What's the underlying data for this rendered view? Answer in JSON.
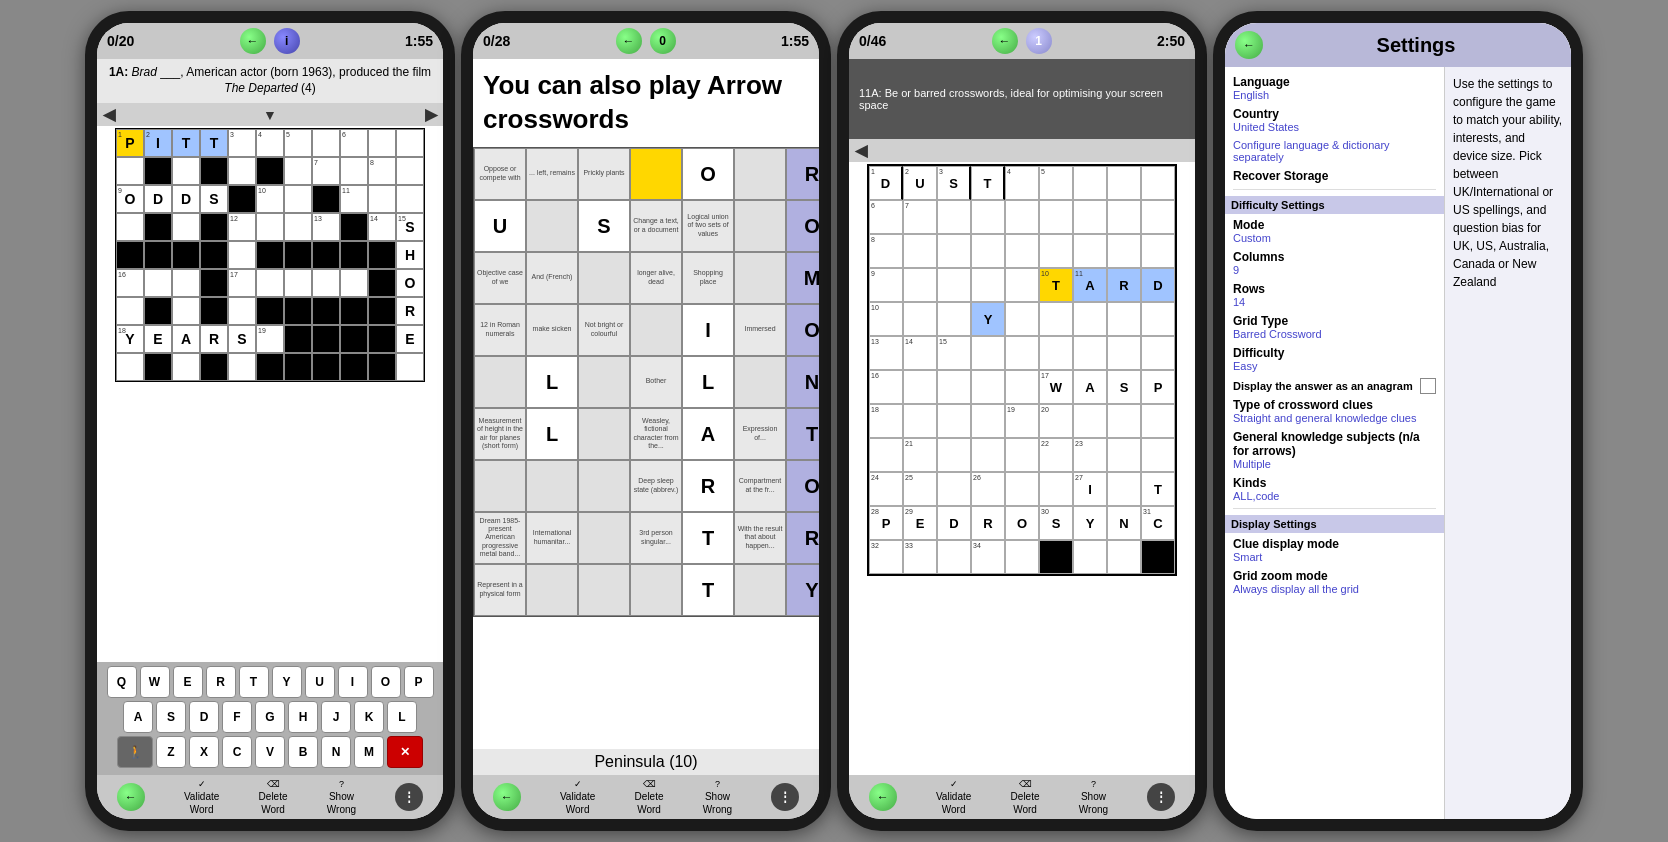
{
  "phones": [
    {
      "id": "phone1",
      "score": "0/20",
      "time": "1:55",
      "clue": "1A: Brad ___, American actor (born 1963), produced the film The Departed (4)",
      "clue_italic": "The Departed",
      "bottom_buttons": [
        "Validate\nWord",
        "Delete\nWord",
        "Show\nWrong"
      ],
      "grid": {
        "cols": 11,
        "rows": 9,
        "highlighted_word": "PITT"
      }
    },
    {
      "id": "phone2",
      "score": "0/28",
      "time": "1:55",
      "big_clue": "You can also play Arrow crosswords",
      "peninsula_label": "Peninsula (10)",
      "bottom_buttons": [
        "Validate\nWord",
        "Delete\nWord",
        "Show\nWrong"
      ]
    },
    {
      "id": "phone3",
      "score": "0/46",
      "time": "2:50",
      "clue": "11A: Be or barred crosswords, ideal for optimising your screen space",
      "bottom_buttons": [
        "Validate\nWord",
        "Delete\nWord",
        "Show\nWrong"
      ]
    },
    {
      "id": "phone4",
      "title": "Settings",
      "right_text": "Use the settings to configure the game to match your ability, interests, and device size. Pick between UK/International or US spellings, and question bias for UK, US, Australia, Canada or New Zealand",
      "sections": [
        {
          "label": "",
          "items": [
            {
              "label": "Language",
              "value": "English"
            },
            {
              "label": "Country",
              "value": "United States"
            },
            {
              "label": "Configure language & dictionary separately",
              "value": ""
            },
            {
              "label": "Recover Storage",
              "value": ""
            }
          ]
        },
        {
          "label": "Difficulty Settings",
          "items": [
            {
              "label": "Mode",
              "value": "Custom"
            },
            {
              "label": "Columns",
              "value": "9"
            },
            {
              "label": "Rows",
              "value": "14"
            },
            {
              "label": "Grid Type",
              "value": "Barred Crossword"
            },
            {
              "label": "Difficulty",
              "value": "Easy"
            },
            {
              "label": "Display the answer as an anagram",
              "value": "",
              "checkbox": true
            },
            {
              "label": "Type of crossword clues",
              "value": "Straight and general knowledge clues"
            },
            {
              "label": "General knowledge subjects (n/a for arrows)",
              "value": "Multiple"
            },
            {
              "label": "Kinds",
              "value": "ALL,code"
            }
          ]
        },
        {
          "label": "Display Settings",
          "items": [
            {
              "label": "Clue display mode",
              "value": "Smart"
            },
            {
              "label": "Grid zoom mode",
              "value": "Always display all the grid"
            }
          ]
        }
      ]
    }
  ],
  "keyboard_rows": [
    [
      "Q",
      "W",
      "E",
      "R",
      "T",
      "Y",
      "U",
      "I",
      "O",
      "P"
    ],
    [
      "A",
      "S",
      "D",
      "F",
      "G",
      "H",
      "J",
      "K",
      "L"
    ],
    [
      "WALK",
      "Z",
      "X",
      "C",
      "V",
      "B",
      "N",
      "M",
      "DEL"
    ]
  ]
}
